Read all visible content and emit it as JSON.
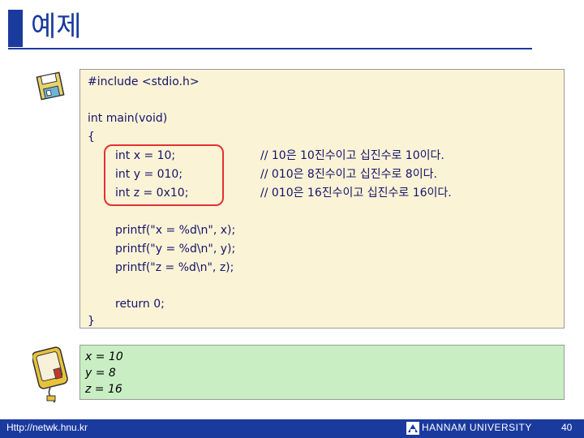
{
  "slide": {
    "title": "예제",
    "page_number": "40"
  },
  "code": {
    "lines": [
      "#include <stdio.h>",
      "int main(void)",
      "{",
      "int x = 10;",
      "int y = 010;",
      "int z = 0x10;",
      "// 10은 10진수이고 십진수로 10이다.",
      "// 010은 8진수이고 십진수로 8이다.",
      "// 010은 16진수이고 십진수로 16이다.",
      "printf(\"x = %d\\n\", x);",
      "printf(\"y = %d\\n\", y);",
      "printf(\"z = %d\\n\", z);",
      "return 0;",
      "}"
    ]
  },
  "output": {
    "lines": [
      "x = 10",
      "y = 8",
      "z = 16"
    ]
  },
  "footer": {
    "url": "Http://netwk.hnu.kr",
    "university": "HANNAM UNIVERSITY"
  },
  "icons": {
    "disk": "floppy-disk-icon",
    "monitor": "monitor-icon",
    "logo": "university-logo-icon"
  },
  "colors": {
    "accent": "#1a3a9e",
    "code_bg": "#fbf3d6",
    "output_bg": "#c9eec4",
    "highlight": "#e23232"
  }
}
